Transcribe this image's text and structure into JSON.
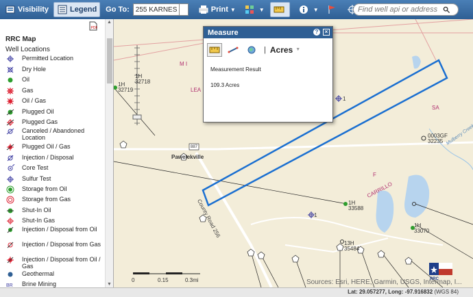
{
  "toolbar": {
    "visibility_label": "Visibility",
    "legend_label": "Legend",
    "goto_label": "Go To:",
    "goto_value": "255 KARNES",
    "print_label": "Print",
    "search_placeholder": "Find well api or address"
  },
  "legend": {
    "title": "RRC Map",
    "subtitle": "Well Locations",
    "items": [
      {
        "label": "Permitted Location",
        "icon": "permitted-location-icon"
      },
      {
        "label": "Dry Hole",
        "icon": "dry-hole-icon"
      },
      {
        "label": "Oil",
        "icon": "oil-icon"
      },
      {
        "label": "Gas",
        "icon": "gas-icon"
      },
      {
        "label": "Oil / Gas",
        "icon": "oil-gas-icon"
      },
      {
        "label": "Plugged Oil",
        "icon": "plugged-oil-icon"
      },
      {
        "label": "Plugged Gas",
        "icon": "plugged-gas-icon"
      },
      {
        "label": "Canceled / Abandoned Location",
        "icon": "canceled-location-icon"
      },
      {
        "label": "Plugged Oil / Gas",
        "icon": "plugged-oil-gas-icon"
      },
      {
        "label": "Injection / Disposal",
        "icon": "injection-disposal-icon"
      },
      {
        "label": "Core Test",
        "icon": "core-test-icon"
      },
      {
        "label": "Sulfur Test",
        "icon": "sulfur-test-icon"
      },
      {
        "label": "Storage from Oil",
        "icon": "storage-oil-icon"
      },
      {
        "label": "Storage from Gas",
        "icon": "storage-gas-icon"
      },
      {
        "label": "Shut-In Oil",
        "icon": "shut-in-oil-icon"
      },
      {
        "label": "Shut-In Gas",
        "icon": "shut-in-gas-icon"
      },
      {
        "label": "Injection / Disposal from Oil",
        "icon": "injection-oil-icon"
      },
      {
        "label": "Injection / Disposal from Gas",
        "icon": "injection-gas-icon"
      },
      {
        "label": "Injection / Disposal from Oil / Gas",
        "icon": "injection-oil-gas-icon"
      },
      {
        "label": "Geothermal",
        "icon": "geothermal-icon"
      },
      {
        "label": "Brine Mining",
        "icon": "brine-mining-icon"
      }
    ]
  },
  "measure": {
    "title": "Measure",
    "unit": "Acres",
    "result_label": "Measurement Result",
    "result_value": "109.3 Acres"
  },
  "map": {
    "labels": {
      "town": "Pawelekville",
      "road": "County Road 256",
      "road_shield": "887",
      "carrillo": "CARRILLO",
      "creek": "Mulberry Creek",
      "mi": "M I",
      "lea": "LEA",
      "f": "F",
      "sa": "SA"
    },
    "wells": [
      {
        "label": "1H",
        "sub": "32719"
      },
      {
        "label": "1H",
        "sub": "32718"
      },
      {
        "label": "1",
        "sub": ""
      },
      {
        "label": "0003GF",
        "sub": "32235"
      },
      {
        "label": "1H",
        "sub": "33588"
      },
      {
        "label": "1",
        "sub": ""
      },
      {
        "label": "1H",
        "sub": "33070"
      },
      {
        "label": "13H",
        "sub": "35484"
      }
    ],
    "scale": {
      "ticks": [
        "0",
        "0.15",
        "0.3mi"
      ]
    },
    "attribution": "Sources: Esri, HERE, Garmin, USGS, Intermap, I...",
    "logo_text": "RRC"
  },
  "status": {
    "lat_label": "Lat:",
    "lat": "29.057277,",
    "long_label": "Long:",
    "long": "-97.916832",
    "datum": "(WGS 84)"
  },
  "colors": {
    "toolbar": "#2f5f94",
    "measure_outline": "#1a6fd1",
    "map_bg": "#f3edd9",
    "water": "#b7d4ee"
  }
}
